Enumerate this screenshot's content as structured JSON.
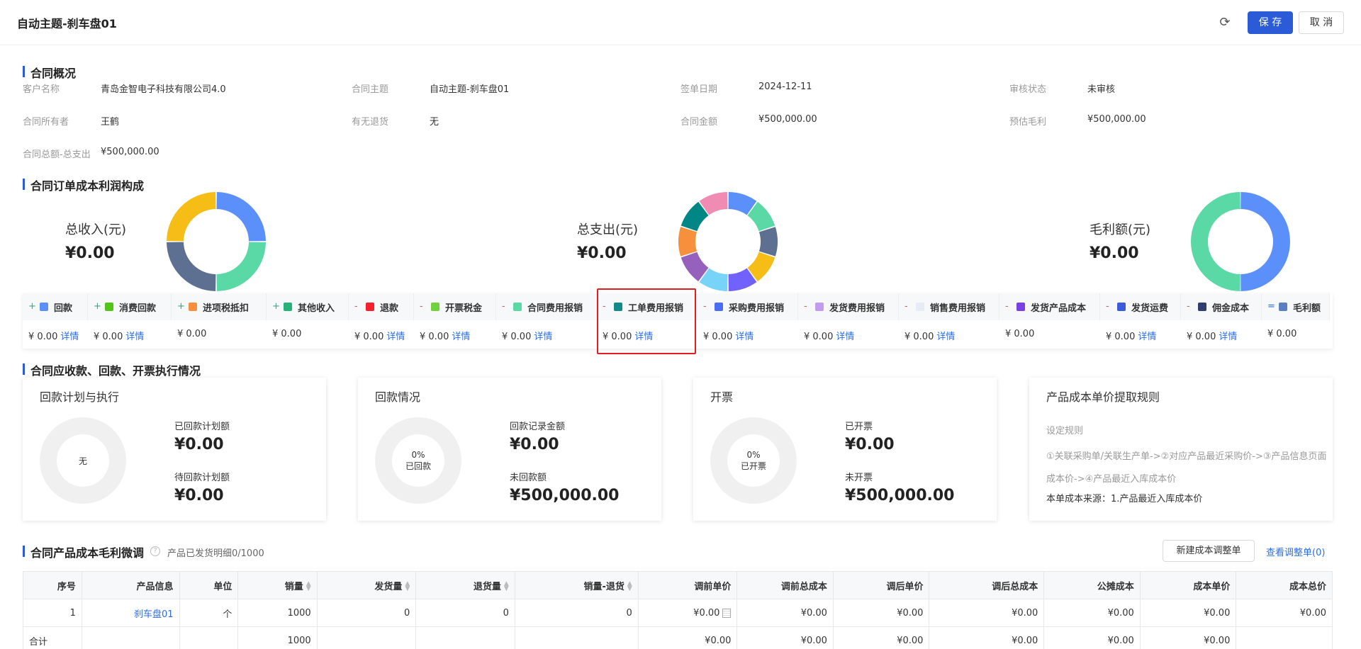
{
  "header": {
    "title": "自动主题-刹车盘01",
    "save_label": "保 存",
    "cancel_label": "取 消"
  },
  "overview": {
    "title": "合同概况",
    "fields": [
      {
        "label": "客户名称",
        "value": "青岛金智电子科技有限公司4.0"
      },
      {
        "label": "合同主题",
        "value": "自动主题-刹车盘01"
      },
      {
        "label": "签单日期",
        "value": "2024-12-11"
      },
      {
        "label": "审核状态",
        "value": "未审核"
      },
      {
        "label": "合同所有者",
        "value": "王鹤"
      },
      {
        "label": "有无退货",
        "value": "无"
      },
      {
        "label": "合同金额",
        "value": "¥500,000.00"
      },
      {
        "label": "预估毛利",
        "value": "¥500,000.00"
      },
      {
        "label": "合同总额-总支出",
        "value": "¥500,000.00"
      }
    ]
  },
  "composition": {
    "title": "合同订单成本利润构成",
    "income": {
      "label": "总收入(元)",
      "amount": "¥0.00",
      "colors": [
        "#5b8ff9",
        "#5ad8a6",
        "#5d7092",
        "#f6bd16"
      ]
    },
    "expense": {
      "label": "总支出(元)",
      "amount": "¥0.00",
      "colors": [
        "#5b8ff9",
        "#5ad8a6",
        "#5d7092",
        "#f6bd16",
        "#7262fd",
        "#78d3f8",
        "#9661bc",
        "#f6903d",
        "#008685",
        "#f08bb4"
      ]
    },
    "profit": {
      "label": "毛利额(元)",
      "amount": "¥0.00",
      "colors": [
        "#5b8ff9",
        "#5ad8a6"
      ]
    }
  },
  "cost_items": [
    {
      "op": "+",
      "label": "回款",
      "color": "#5b8ff9",
      "value": "¥ 0.00",
      "link": "详情"
    },
    {
      "op": "+",
      "label": "消费回款",
      "color": "#52c41a",
      "value": "¥ 0.00",
      "link": "详情"
    },
    {
      "op": "+",
      "label": "进项税抵扣",
      "color": "#f6903d",
      "value": "¥ 0.00",
      "link": ""
    },
    {
      "op": "+",
      "label": "其他收入",
      "color": "#27b27a",
      "value": "¥ 0.00",
      "link": ""
    },
    {
      "op": "-",
      "label": "退款",
      "color": "#f5222d",
      "value": "¥ 0.00",
      "link": "详情"
    },
    {
      "op": "-",
      "label": "开票税金",
      "color": "#73d13d",
      "value": "¥ 0.00",
      "link": "详情"
    },
    {
      "op": "-",
      "label": "合同费用报销",
      "color": "#5ad8a6",
      "value": "¥ 0.00",
      "link": "详情"
    },
    {
      "op": "-",
      "label": "工单费用报销",
      "color": "#13898c",
      "value": "¥ 0.00",
      "link": "详情"
    },
    {
      "op": "-",
      "label": "采购费用报销",
      "color": "#4a6cf7",
      "value": "¥ 0.00",
      "link": "详情"
    },
    {
      "op": "-",
      "label": "发货费用报销",
      "color": "#c39cf0",
      "value": "¥ 0.00",
      "link": "详情"
    },
    {
      "op": "-",
      "label": "销售费用报销",
      "color": "#e6ebf5",
      "value": "¥ 0.00",
      "link": "详情"
    },
    {
      "op": "-",
      "label": "发货产品成本",
      "color": "#7b3fe4",
      "value": "¥ 0.00",
      "link": ""
    },
    {
      "op": "-",
      "label": "发货运费",
      "color": "#3b5bdb",
      "value": "¥ 0.00",
      "link": "详情"
    },
    {
      "op": "-",
      "label": "佣金成本",
      "color": "#2f3e6e",
      "value": "¥ 0.00",
      "link": "详情"
    },
    {
      "op": "=",
      "label": "毛利额",
      "color": "#5b7fc0",
      "value": "¥ 0.00",
      "link": ""
    }
  ],
  "execution": {
    "title": "合同应收款、回款、开票执行情况",
    "plan": {
      "title": "回款计划与执行",
      "center": "无",
      "k1": "已回款计划额",
      "v1": "¥0.00",
      "k2": "待回款计划额",
      "v2": "¥0.00"
    },
    "receipts": {
      "title": "回款情况",
      "pct": "0%",
      "center": "已回款",
      "k1": "回款记录金额",
      "v1": "¥0.00",
      "k2": "未回款额",
      "v2": "¥500,000.00"
    },
    "invoice": {
      "title": "开票",
      "pct": "0%",
      "center": "已开票",
      "k1": "已开票",
      "v1": "¥0.00",
      "k2": "未开票",
      "v2": "¥500,000.00"
    },
    "rules": {
      "title": "产品成本单价提取规则",
      "label": "设定规则",
      "text": "①关联采购单/关联生产单->②对应产品最近采购价->③产品信息页面成本价->④产品最近入库成本价",
      "source": "本单成本来源：1.产品最近入库成本价"
    }
  },
  "products": {
    "title": "合同产品成本毛利微调",
    "note": "产品已发货明细0/1000",
    "new_button": "新建成本调整单",
    "view_link": "查看调整单(0)",
    "columns": [
      "序号",
      "产品信息",
      "单位",
      "销量",
      "发货量",
      "退货量",
      "销量-退货",
      "调前单价",
      "调前总成本",
      "调后单价",
      "调后总成本",
      "公摊成本",
      "成本单价",
      "成本总价"
    ],
    "rows": [
      [
        "1",
        "刹车盘01",
        "个",
        "1000",
        "0",
        "0",
        "0",
        "¥0.00",
        "¥0.00",
        "¥0.00",
        "¥0.00",
        "¥0.00",
        "¥0.00",
        "¥0.00"
      ]
    ],
    "total": [
      "合计",
      "",
      "",
      "1000",
      "",
      "",
      "",
      "¥0.00",
      "¥0.00",
      "¥0.00",
      "¥0.00",
      "¥0.00",
      "¥0.00",
      ""
    ]
  }
}
